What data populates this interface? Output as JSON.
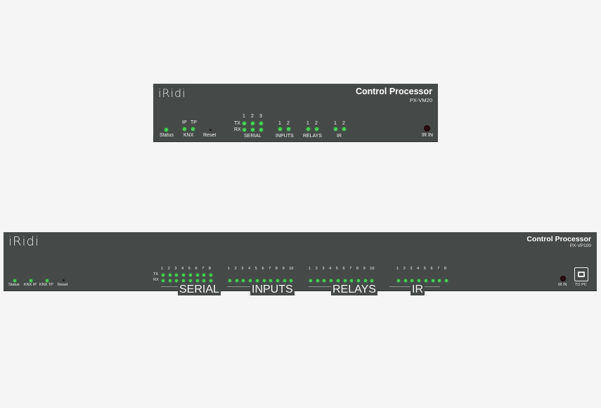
{
  "small_unit": {
    "logo": "iRidi",
    "title": "Control Processor",
    "model": "PX-VM20",
    "status_label": "Status",
    "knx": {
      "label": "KNX",
      "ip": "IP",
      "tp": "TP"
    },
    "reset_label": "Reset",
    "tx_label": "TX",
    "rx_label": "RX",
    "serial": {
      "label": "SERIAL",
      "channels": [
        "1",
        "2",
        "3"
      ]
    },
    "inputs": {
      "label": "INPUTS",
      "channels": [
        "1",
        "2"
      ]
    },
    "relays": {
      "label": "RELAYS",
      "channels": [
        "1",
        "2"
      ]
    },
    "ir": {
      "label": "IR",
      "channels": [
        "1",
        "2"
      ]
    },
    "ir_in_label": "IR IN"
  },
  "large_unit": {
    "logo": "iRidi",
    "title": "Control Processor",
    "model": "PX-VP100",
    "status_label": "Status",
    "knx_ip_label": "KNX IP",
    "knx_tp_label": "KNX TP",
    "reset_label": "Reset",
    "tx_label": "TX",
    "rx_label": "RX",
    "serial": {
      "label": "SERIAL",
      "channels": [
        "1",
        "2",
        "3",
        "4",
        "5",
        "6",
        "7",
        "8"
      ]
    },
    "inputs": {
      "label": "INPUTS",
      "channels": [
        "1",
        "2",
        "3",
        "4",
        "5",
        "6",
        "7",
        "8",
        "9",
        "10"
      ]
    },
    "relays": {
      "label": "RELAYS",
      "channels": [
        "1",
        "2",
        "3",
        "4",
        "5",
        "6",
        "7",
        "8",
        "9",
        "10"
      ]
    },
    "ir": {
      "label": "IR",
      "channels": [
        "1",
        "2",
        "3",
        "4",
        "5",
        "6",
        "7",
        "8"
      ]
    },
    "ir_in_label": "IR IN",
    "to_pc_label": "TO PC"
  },
  "colors": {
    "panel": "#454a48",
    "led": "#44d452",
    "text": "#f2f4f3",
    "ir_window": "#2a0e12",
    "background": "#f4f5f4"
  }
}
